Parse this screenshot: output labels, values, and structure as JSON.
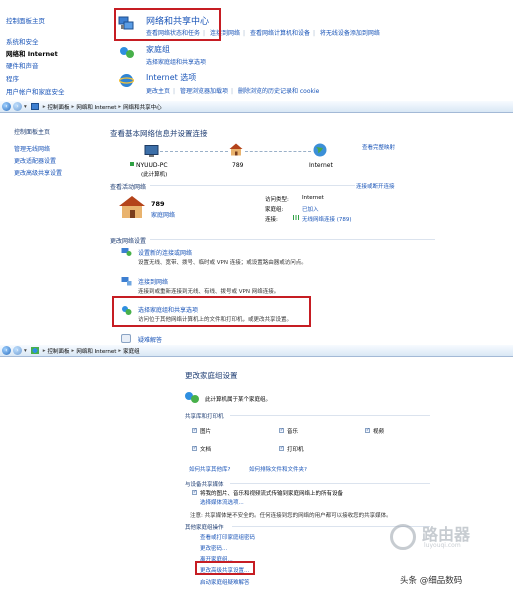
{
  "win1": {
    "left_items": [
      "控制面板主页",
      "系统和安全",
      "网络和 Internet",
      "硬件和声音",
      "程序",
      "用户帐户和家庭安全"
    ],
    "sec_network": {
      "title": "网络和共享中心",
      "links": [
        "查看网络状态和任务",
        "连接到网络",
        "查看网络计算机和设备",
        "将无线设备添加到网络"
      ]
    },
    "sec_homegroup": {
      "title": "家庭组",
      "links": [
        "选择家庭组和共享选项"
      ]
    },
    "sec_internet": {
      "title": "Internet 选项",
      "links": [
        "更改主页",
        "管理浏览器加载项",
        "删除浏览的历史记录和 cookie"
      ]
    }
  },
  "win2": {
    "breadcrumb": [
      "控制面板",
      "网络和 Internet",
      "网络和共享中心"
    ],
    "left_items": [
      "控制面板主页",
      "管理无线网络",
      "更改适配器设置",
      "更改高级共享设置"
    ],
    "heading": "查看基本网络信息并设置连接",
    "full_map": "查看完整映射",
    "map": {
      "pc_name": "NYUUD-PC",
      "pc_sub": "(此计算机)",
      "net": "789",
      "internet": "Internet"
    },
    "active_label": "查看活动网络",
    "connect_link": "连接或断开连接",
    "network": {
      "name": "789",
      "type": "家庭网络"
    },
    "props": {
      "access_label": "访问类型:",
      "access_value": "Internet",
      "hg_label": "家庭组:",
      "hg_value": "已加入",
      "conn_label": "连接:",
      "conn_value": "无线网络连接 (789)"
    },
    "change_label": "更改网络设置",
    "tasks": [
      {
        "title": "设置新的连接或网络",
        "desc": "设置无线、宽带、拨号、临时或 VPN 连接；或设置路由器或访问点。"
      },
      {
        "title": "连接到网络",
        "desc": "连接到或重新连接到无线、有线、拨号或 VPN 网络连接。"
      },
      {
        "title": "选择家庭组和共享选项",
        "desc": "访问位于其他网络计算机上的文件和打印机，或更改共享设置。"
      },
      {
        "title": "疑难解答",
        "desc": ""
      }
    ]
  },
  "win3": {
    "breadcrumb": [
      "控制面板",
      "网络和 Internet",
      "家庭组"
    ],
    "heading": "更改家庭组设置",
    "status": "此计算机属于某个家庭组。",
    "share_label": "共享库和打印机",
    "checks": [
      "图片",
      "音乐",
      "视频",
      "文档",
      "打印机"
    ],
    "links1": [
      "如何共享其他库?",
      "如何排除文件和文件夹?"
    ],
    "media_label": "与设备共享媒体",
    "media_check": "将我的图片、音乐和视频流式传输到家庭网络上的所有设备",
    "media_link": "选择媒体流选项...",
    "note": "注意: 共享媒体是不安全的。任何连接到您的网络的用户都可以接收您的共享媒体。",
    "other_label": "其他家庭组操作",
    "other_links": [
      "查看或打印家庭组密码",
      "更改密码...",
      "离开家庭组...",
      "更改高级共享设置...",
      "启动家庭组疑难解答"
    ]
  },
  "watermark": {
    "brand": "路由器",
    "site": "luyouqi.com",
    "author": "头条 @细品数码"
  }
}
